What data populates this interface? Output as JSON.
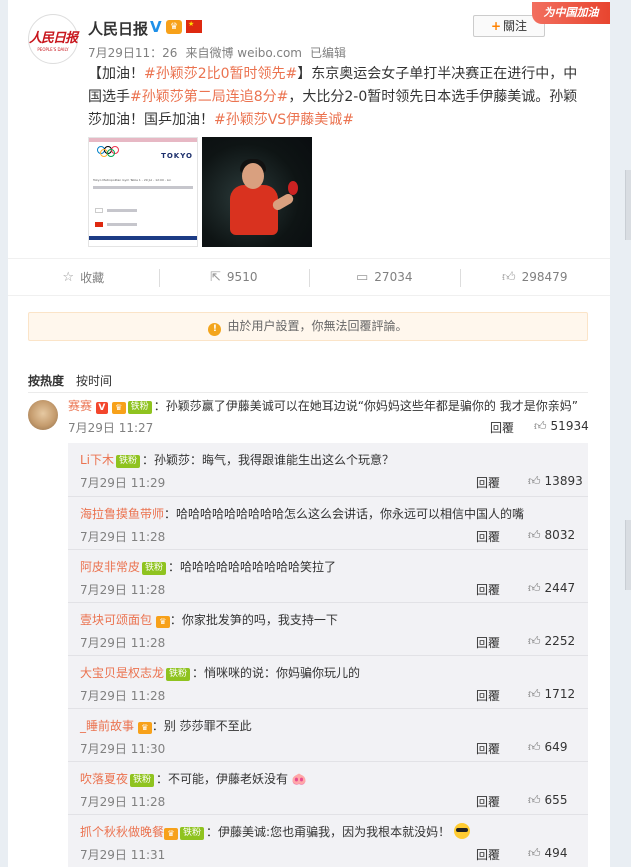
{
  "post": {
    "author": "人民日报",
    "avatar_text": "人民日报",
    "avatar_sub": "PEOPLE'S DAILY",
    "time": "7月29日11：26",
    "source": "来自微博 weibo.com",
    "edited": "已编辑",
    "follow_label": "關注",
    "banner": "为中国加油",
    "text_parts": {
      "p1": "【加油！",
      "tag1": "#孙颖莎2比0暂时领先#",
      "p2": "】东京奥运会女子单打半决赛正在进行中，中国选手",
      "tag2": "#孙颖莎第二局连追8分#",
      "p3": "，大比分2-0暂时领先日本选手伊藤美诚。孙颖莎加油！国乒加油！",
      "tag3": "#孙颖莎VS伊藤美诚#"
    },
    "image1_title": "TOKYO",
    "image1_caption": "Tokyo Metropolitan Gym Table 1 - 29 Jul - 12:00 - Lin"
  },
  "actions": {
    "favorite": "收藏",
    "repost": "9510",
    "comment": "27034",
    "like": "298479"
  },
  "notice": "由於用户設置，你無法回覆評論。",
  "sort": {
    "hot": "按热度",
    "time": "按时间"
  },
  "top_comment": {
    "nick": "赛赛",
    "badge": "铁粉",
    "text": "：孙颖莎赢了伊藤美诚可以在她耳边说“你妈妈这些年都是骗你的 我才是你亲妈”",
    "time": "7月29日 11:27",
    "reply": "回覆",
    "likes": "51934"
  },
  "replies": [
    {
      "nick": "Li下木",
      "badge": "铁粉",
      "text": "：孙颖莎：晦气，我得跟谁能生出这么个玩意？",
      "time": "7月29日 11:29",
      "reply": "回覆",
      "likes": "13893"
    },
    {
      "nick": "海拉鲁摸鱼带师",
      "badge": "",
      "text": "：哈哈哈哈哈哈哈哈哈怎么这么会讲话，你永远可以相信中国人的嘴",
      "time": "7月29日 11:28",
      "reply": "回覆",
      "likes": "8032"
    },
    {
      "nick": "阿皮非常皮",
      "badge": "铁粉",
      "text": "：哈哈哈哈哈哈哈哈哈哈笑拉了",
      "time": "7月29日 11:28",
      "reply": "回覆",
      "likes": "2447"
    },
    {
      "nick": "壹块可颂面包",
      "badge": "",
      "text": "：你家批发笋的吗，我支持一下",
      "time": "7月29日 11:28",
      "reply": "回覆",
      "likes": "2252"
    },
    {
      "nick": "大宝贝是权志龙",
      "badge": "铁粉",
      "text": "：悄咪咪的说：你妈骗你玩儿的",
      "time": "7月29日 11:28",
      "reply": "回覆",
      "likes": "1712"
    },
    {
      "nick": "_睡前故事",
      "badge": "",
      "text": "：别 莎莎罪不至此",
      "time": "7月29日 11:30",
      "reply": "回覆",
      "likes": "649"
    },
    {
      "nick": "吹落夏夜",
      "badge": "铁粉",
      "text": "：不可能，伊藤老妖没有",
      "time": "7月29日 11:28",
      "reply": "回覆",
      "likes": "655"
    },
    {
      "nick": "抓个秋秋做晚餐",
      "badge": "铁粉",
      "text": "：伊藤美诚:您也甭骗我，因为我根本就没妈！",
      "time": "7月29日 11:31",
      "reply": "回覆",
      "likes": "494"
    }
  ]
}
